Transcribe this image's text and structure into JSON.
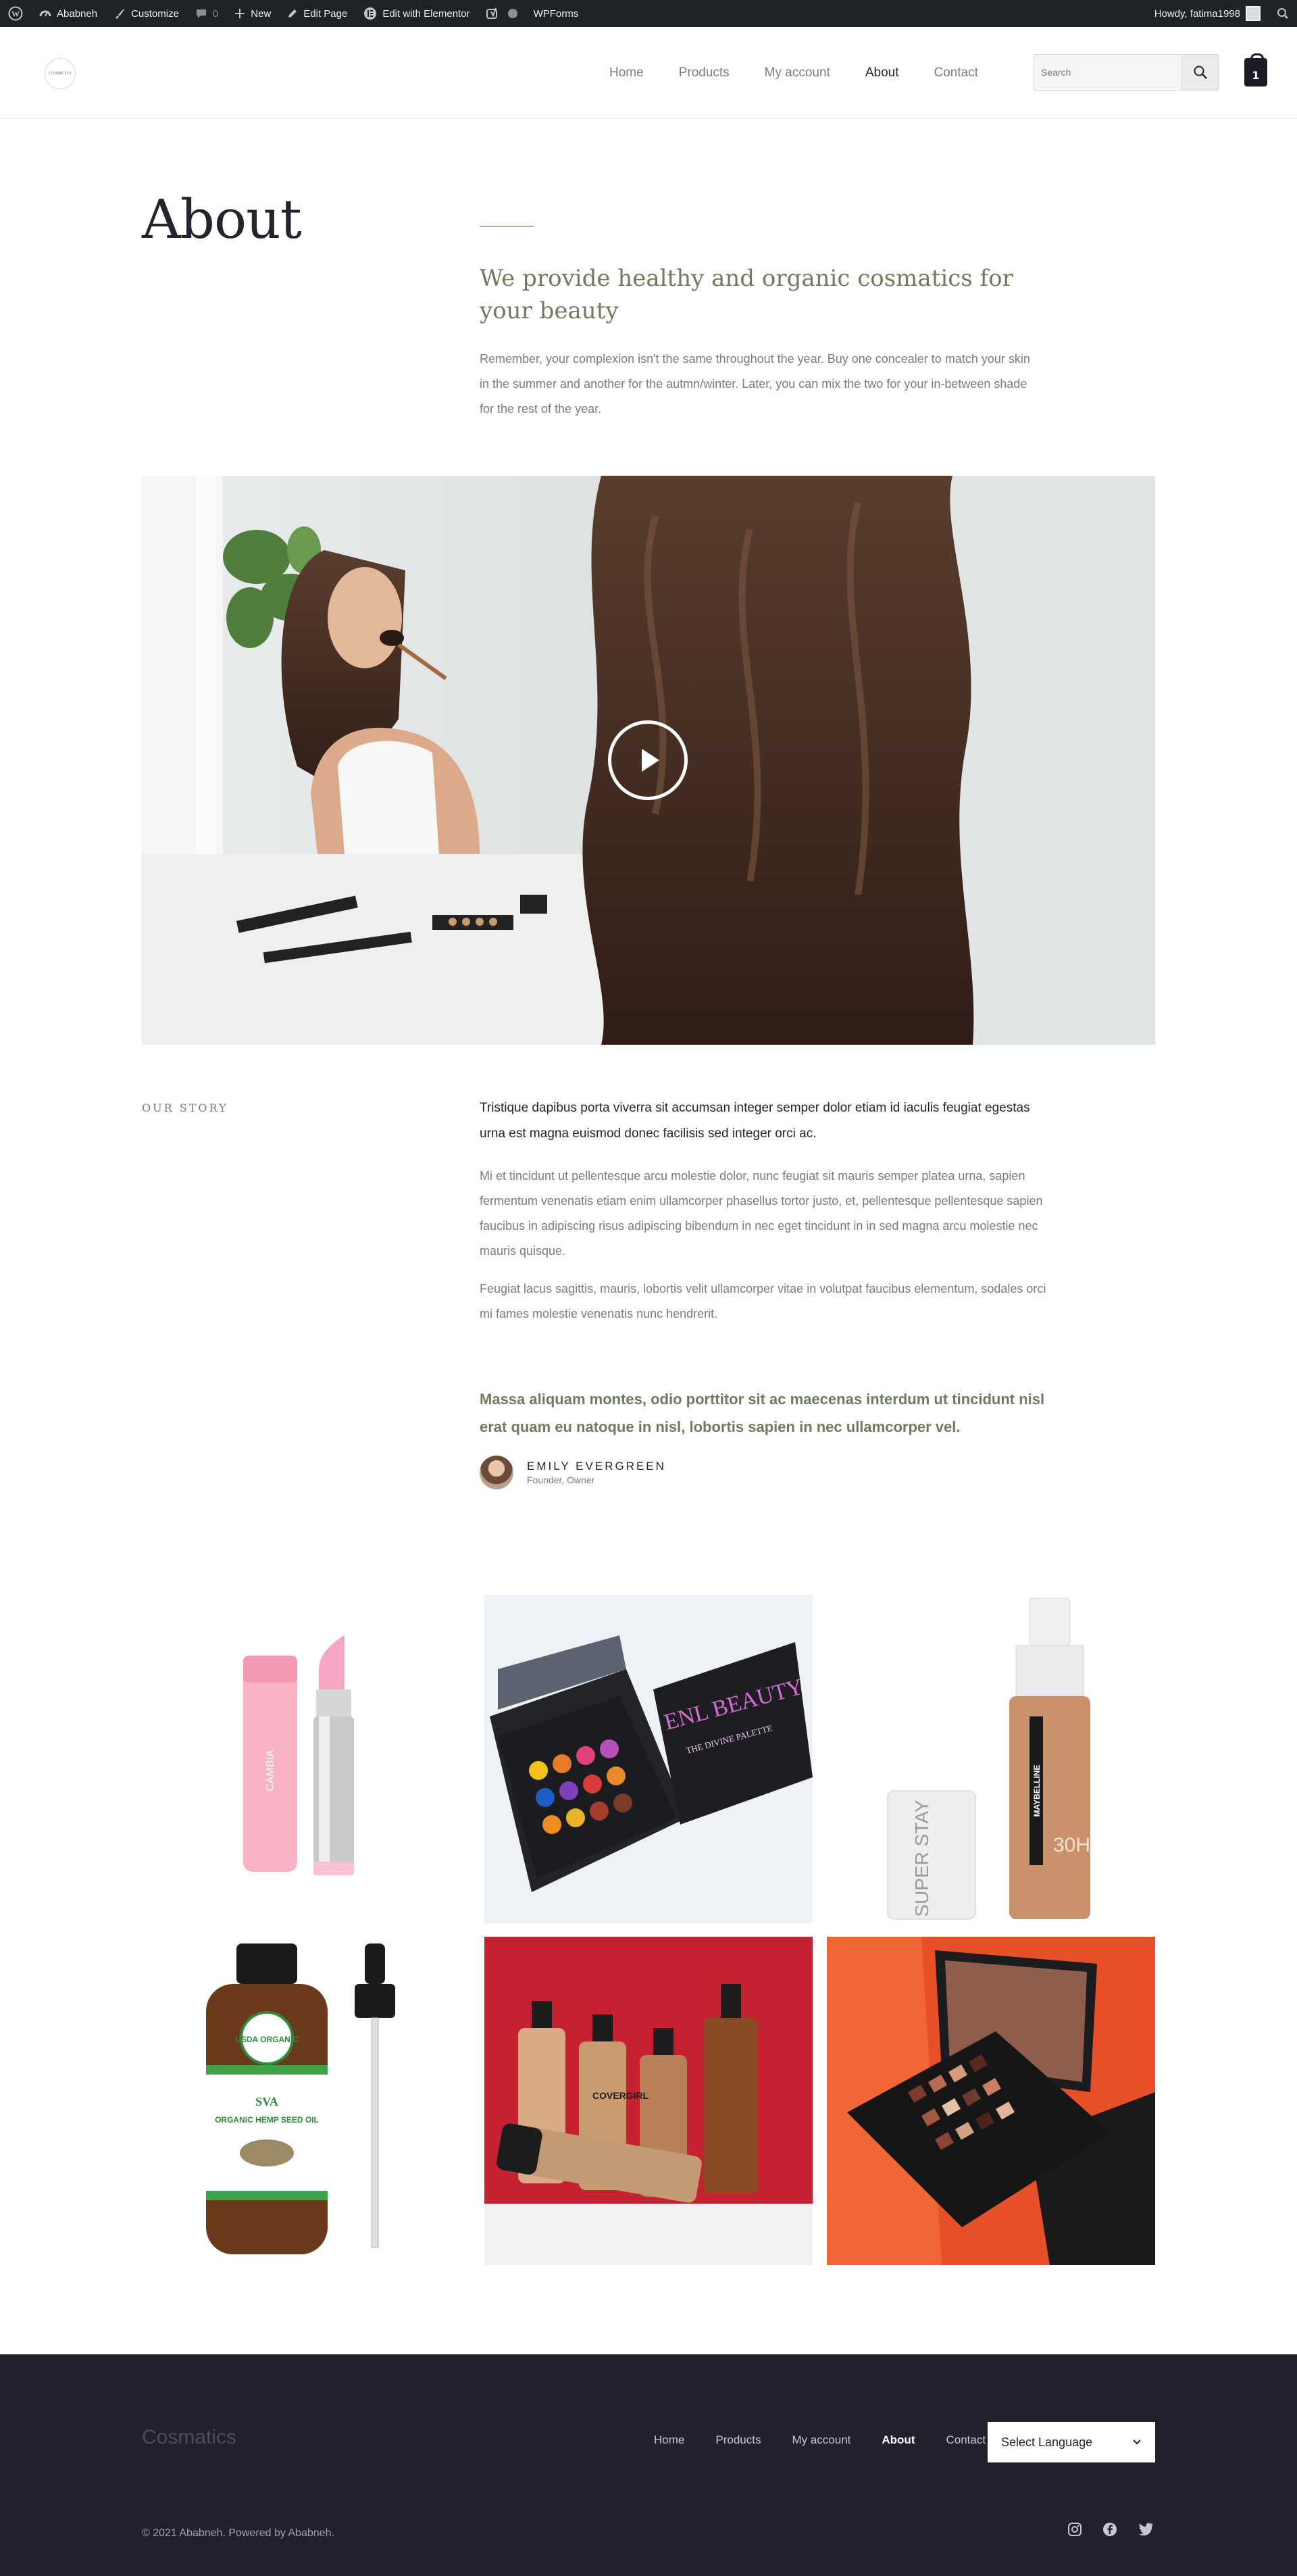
{
  "admin_bar": {
    "items": [
      {
        "label": "Ababneh",
        "icon": "dashboard-icon"
      },
      {
        "label": "Customize",
        "icon": "brush-icon"
      },
      {
        "label": "0",
        "icon": "comment-icon"
      },
      {
        "label": "New",
        "icon": "plus-icon"
      },
      {
        "label": "Edit Page",
        "icon": "pencil-icon"
      },
      {
        "label": "Edit with Elementor",
        "icon": "elementor-icon"
      },
      {
        "label": "",
        "icon": "yoast-icon"
      },
      {
        "label": "WPForms",
        "icon": "wpforms-icon"
      }
    ],
    "greeting": "Howdy, fatima1998"
  },
  "header": {
    "logo_text": "COSMETIX",
    "nav": [
      "Home",
      "Products",
      "My account",
      "About",
      "Contact"
    ],
    "active_nav": "About",
    "search_placeholder": "Search",
    "cart_count": "1"
  },
  "intro": {
    "title": "About",
    "heading": "We provide healthy and organic cosmatics for your beauty",
    "text": "Remember, your complexion isn't the same throughout the year. Buy one concealer to match your skin in the summer and another for the autmn/winter. Later, you can mix the two for your in-between shade for the rest of the year."
  },
  "story": {
    "label": "OUR STORY",
    "lead": "Tristique dapibus porta viverra sit accumsan integer semper dolor etiam id iaculis feugiat egestas urna est magna euismod donec facilisis sed integer orci ac.",
    "p1": "Mi et tincidunt ut pellentesque arcu molestie dolor, nunc feugiat sit mauris semper platea urna, sapien fermentum venenatis etiam enim ullamcorper phasellus tortor justo, et, pellentesque pellentesque sapien faucibus in adipiscing risus adipiscing bibendum in nec eget tincidunt in in sed magna arcu molestie nec mauris quisque.",
    "p2": "Feugiat lacus sagittis, mauris, lobortis velit ullamcorper vitae in volutpat faucibus elementum, sodales orci mi fames molestie venenatis nunc hendrerit.",
    "quote": "Massa aliquam montes, odio porttitor sit ac maecenas interdum ut tincidunt nisl erat quam eu natoque in nisl, lobortis sapien in nec ullamcorper vel.",
    "author_name": "EMILY EVERGREEN",
    "author_role": "Founder, Owner"
  },
  "gallery": {
    "lipstick_brand": "CAMBIA",
    "palette_brand": "ENL BEAUTY",
    "palette_sub": "THE DIVINE PALETTE",
    "foundation_brand": "MAYBELLINE",
    "foundation_hours": "30H",
    "superstay": "SUPER STAY",
    "oil_badge": "USDA ORGANIC",
    "oil_brand": "SVA",
    "oil_label": "ORGANIC HEMP SEED OIL",
    "covergirl": "COVERGIRL"
  },
  "footer": {
    "brand": "Cosmatics",
    "nav": [
      "Home",
      "Products",
      "My account",
      "About",
      "Contact"
    ],
    "active_nav": "About",
    "language": "Select Language",
    "copyright": "© 2021 Ababneh. Powered by Ababneh."
  },
  "colors": {
    "admin_bar": "#1d2327",
    "accent_green": "#6f7a5e",
    "footer_bg": "#23202e"
  }
}
